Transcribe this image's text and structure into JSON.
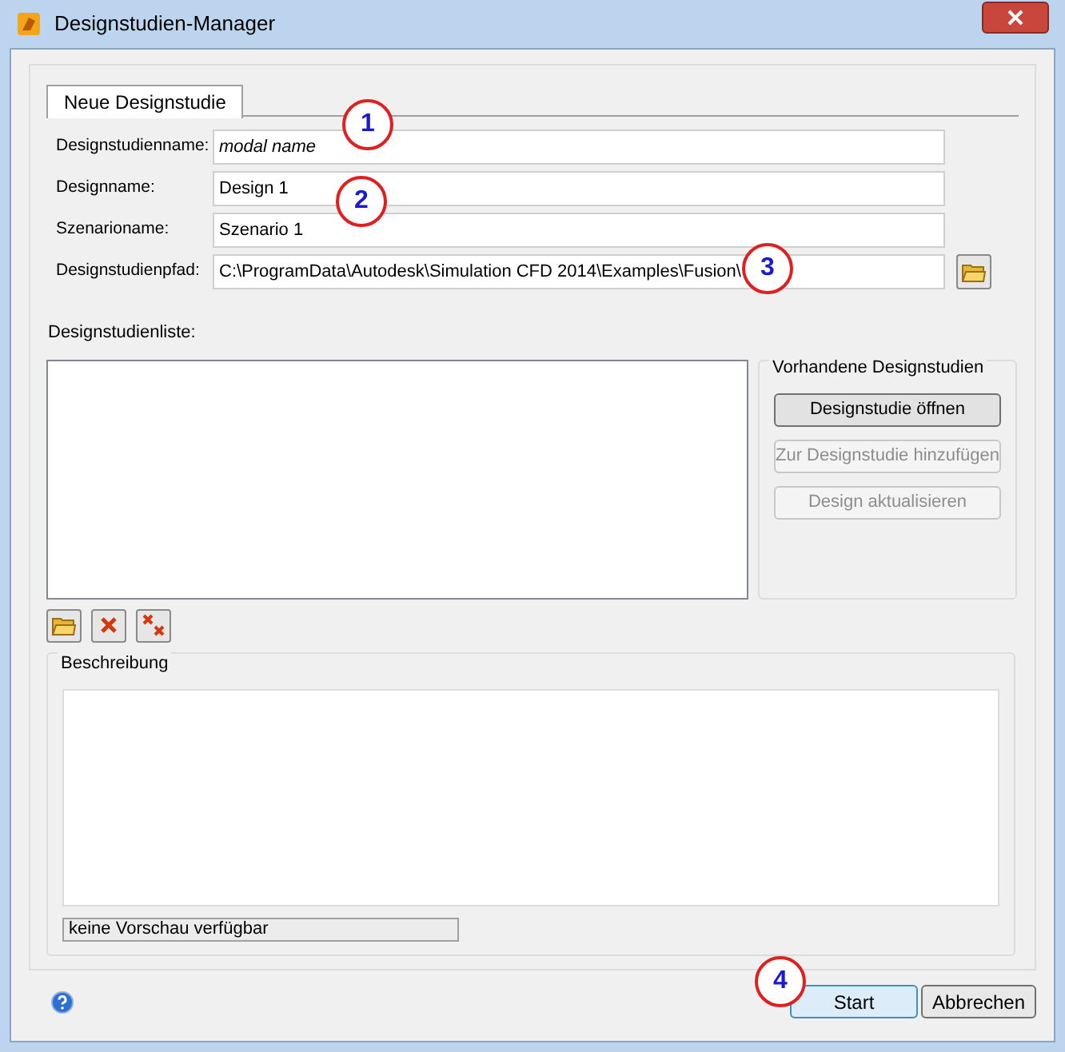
{
  "window": {
    "title": "Designstudien-Manager"
  },
  "tabs": [
    {
      "label": "Neue Designstudie",
      "selected": true
    }
  ],
  "fields": [
    {
      "label": "Designstudienname:",
      "value": "modal name",
      "italic": true,
      "browse": false
    },
    {
      "label": "Designname:",
      "value": "Design 1",
      "italic": false,
      "browse": false
    },
    {
      "label": "Szenarioname:",
      "value": "Szenario 1",
      "italic": false,
      "browse": false
    },
    {
      "label": "Designstudienpfad:",
      "value": "C:\\ProgramData\\Autodesk\\Simulation CFD 2014\\Examples\\Fusion\\",
      "italic": false,
      "browse": true
    }
  ],
  "study_list": {
    "label": "Designstudienliste:"
  },
  "existing_group": {
    "title": "Vorhandene Designstudien",
    "buttons": [
      {
        "label": "Designstudie öffnen",
        "disabled": false
      },
      {
        "label": "Zur Designstudie hinzufügen",
        "disabled": true
      },
      {
        "label": "Design aktualisieren",
        "disabled": true
      }
    ]
  },
  "description": {
    "title": "Beschreibung",
    "preview_status": "keine Vorschau verfügbar"
  },
  "callouts": [
    "1",
    "2",
    "3",
    "4"
  ],
  "buttons": [
    {
      "label": "Start",
      "default": true
    },
    {
      "label": "Abbrechen",
      "default": false
    }
  ]
}
